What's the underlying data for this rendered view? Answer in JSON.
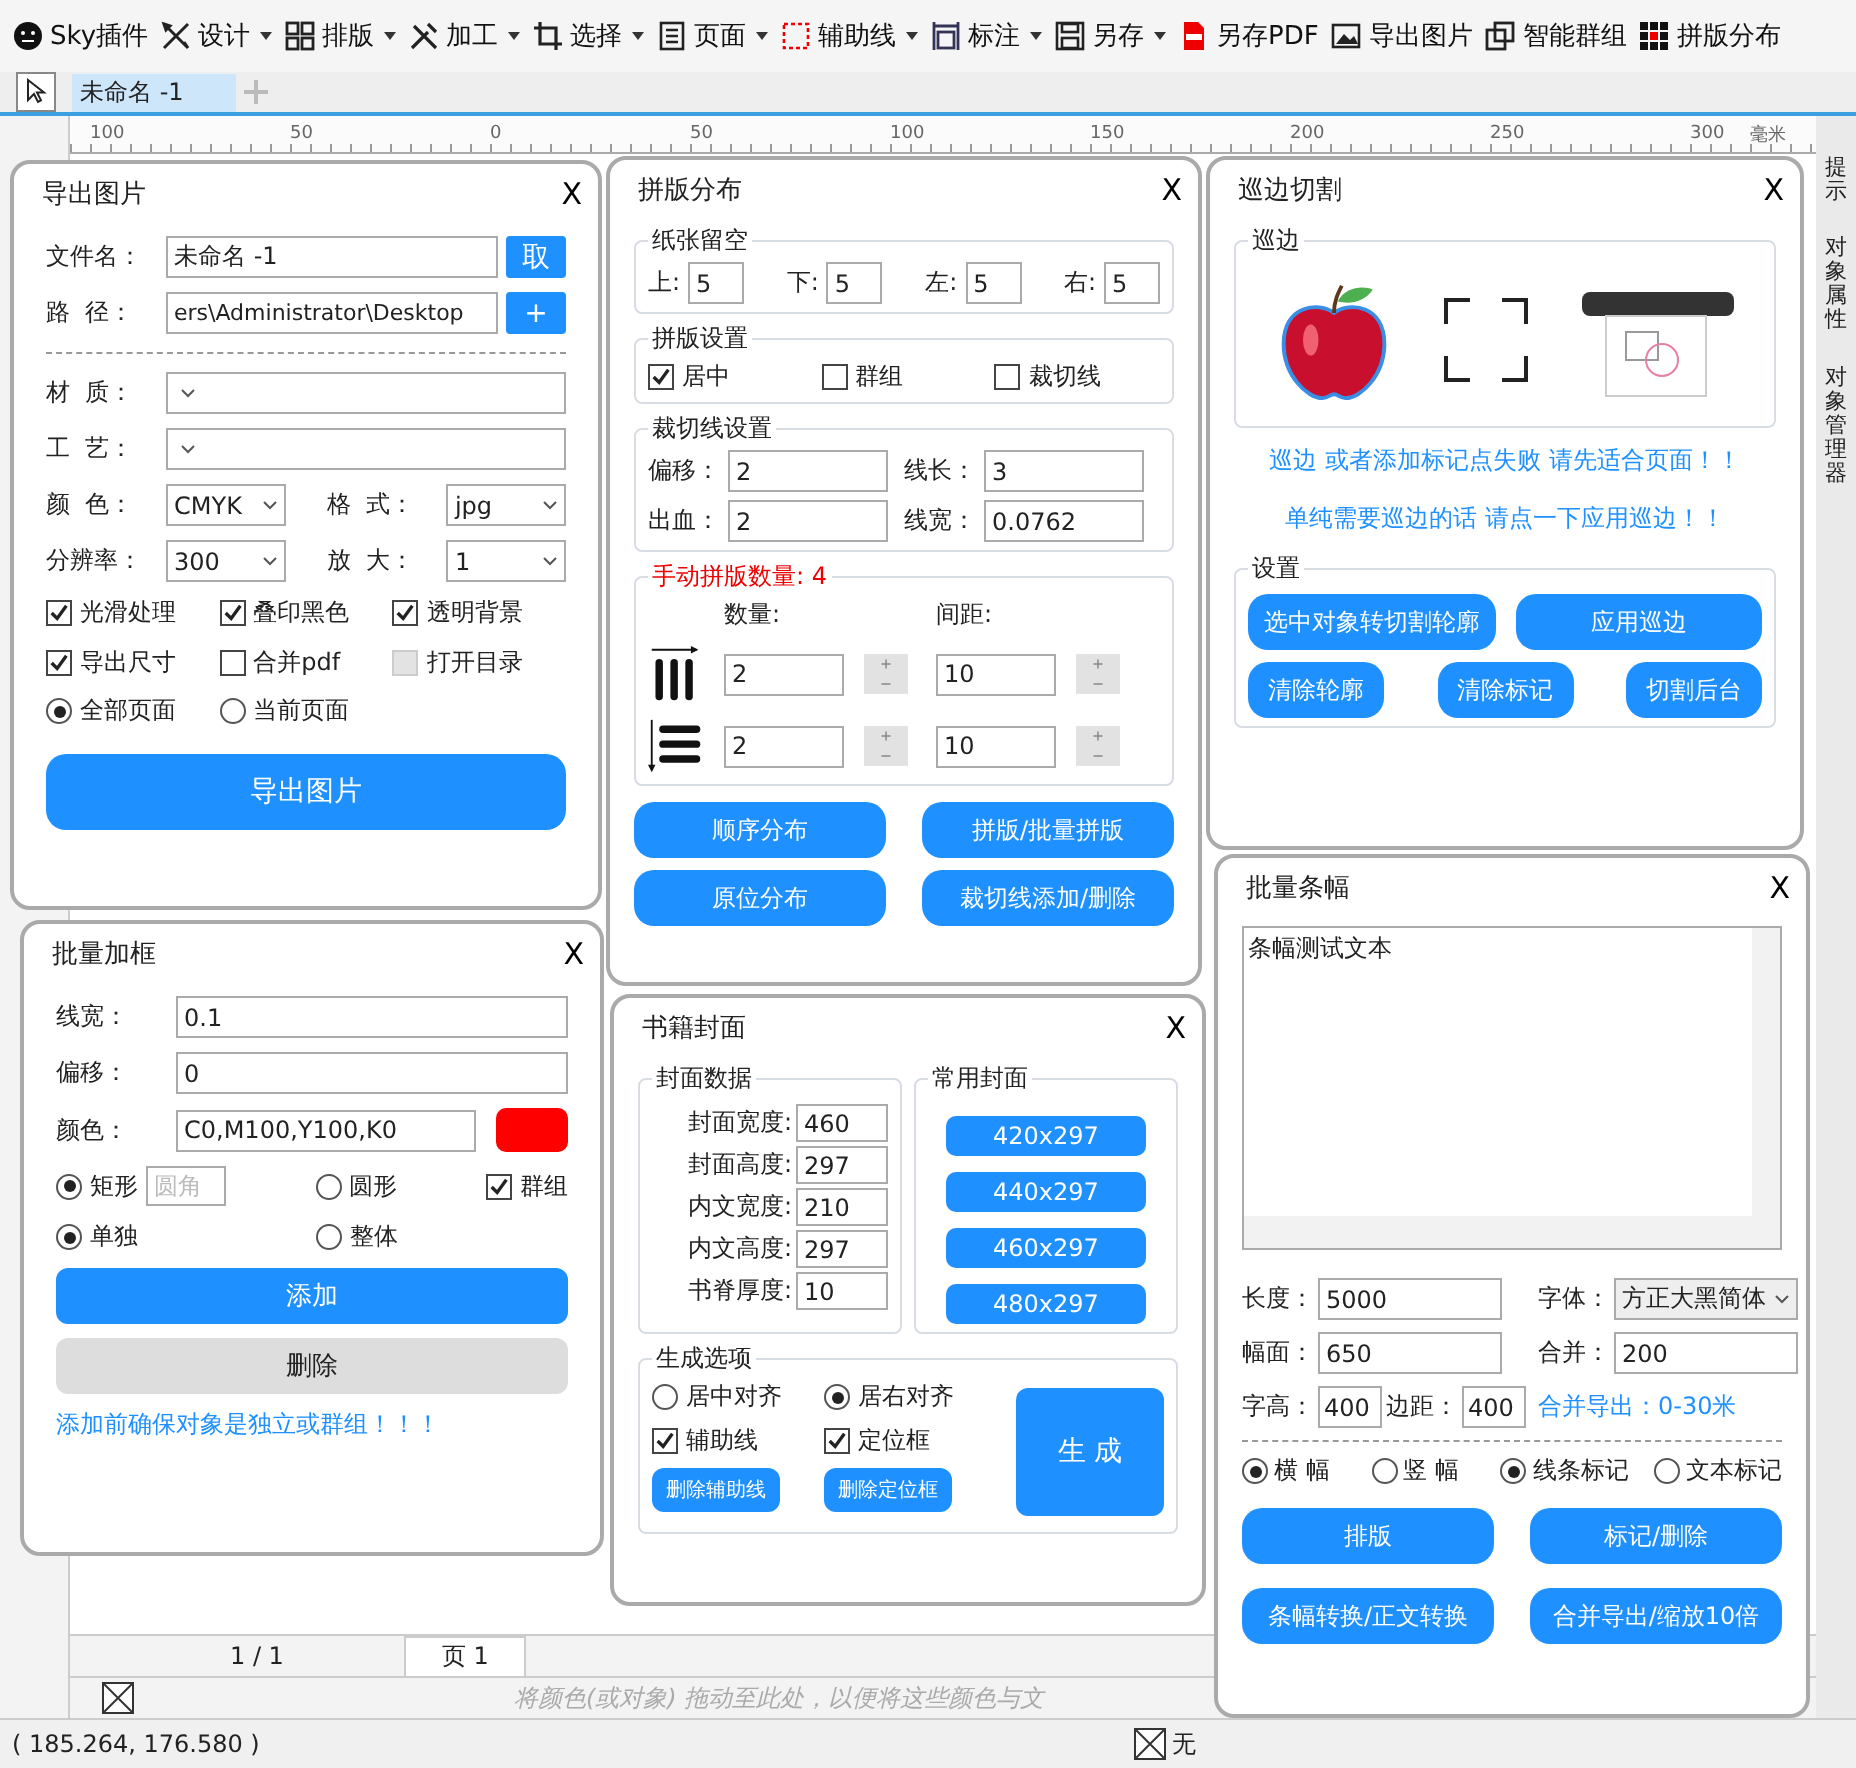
{
  "toolbar": [
    {
      "kind": "plugin",
      "label": "Sky插件",
      "menu": false
    },
    {
      "kind": "design",
      "label": "设计",
      "menu": true
    },
    {
      "kind": "layout",
      "label": "排版",
      "menu": true
    },
    {
      "kind": "process",
      "label": "加工",
      "menu": true
    },
    {
      "kind": "select",
      "label": "选择",
      "menu": true
    },
    {
      "kind": "page",
      "label": "页面",
      "menu": true
    },
    {
      "kind": "guides",
      "label": "辅助线",
      "menu": true
    },
    {
      "kind": "dimension",
      "label": "标注",
      "menu": true
    },
    {
      "kind": "save",
      "label": "另存",
      "menu": true
    },
    {
      "kind": "pdf",
      "label": "另存PDF",
      "menu": false
    },
    {
      "kind": "image",
      "label": "导出图片",
      "menu": false
    },
    {
      "kind": "group",
      "label": "智能群组",
      "menu": false
    },
    {
      "kind": "impose",
      "label": "拼版分布",
      "menu": false
    }
  ],
  "document_tabs": [
    {
      "label": "未命名 -1",
      "selected": true
    }
  ],
  "ruler": {
    "labels": [
      "100",
      "50",
      "0",
      "50",
      "100",
      "150",
      "200",
      "250",
      "300"
    ],
    "unit": "毫米"
  },
  "dockers": [
    "提示",
    "对象属性",
    "对象管理器"
  ],
  "export_panel": {
    "title": "导出图片",
    "close": "X",
    "file_name": {
      "label": "文件名：",
      "value": "未命名 -1",
      "button": "取"
    },
    "path": {
      "label": "路  径：",
      "value": "ers\\Administrator\\Desktop",
      "button": "+"
    },
    "material": {
      "label": "材  质："
    },
    "craft": {
      "label": "工  艺："
    },
    "color": {
      "label": "颜  色：",
      "value": "CMYK"
    },
    "format": {
      "label": "格  式：",
      "value": "jpg"
    },
    "resolution": {
      "label": "分辨率：",
      "value": "300"
    },
    "scale": {
      "label": "放  大：",
      "value": "1"
    },
    "options": [
      {
        "label": "光滑处理",
        "checked": true,
        "disabled": false
      },
      {
        "label": "叠印黑色",
        "checked": true,
        "disabled": false
      },
      {
        "label": "透明背景",
        "checked": true,
        "disabled": false
      },
      {
        "label": "导出尺寸",
        "checked": true,
        "disabled": false
      },
      {
        "label": "合并pdf",
        "checked": false,
        "disabled": false
      },
      {
        "label": "打开目录",
        "checked": false,
        "disabled": true
      }
    ],
    "pages": [
      {
        "label": "全部页面",
        "selected": true
      },
      {
        "label": "当前页面",
        "selected": false
      }
    ],
    "submit": "导出图片"
  },
  "frame_panel": {
    "title": "批量加框",
    "close": "X",
    "fields": [
      {
        "label": "线宽：",
        "value": "0.1"
      },
      {
        "label": "偏移：",
        "value": "0"
      },
      {
        "label": "颜色：",
        "value": "C0,M100,Y100,K0",
        "color": "#ff0000"
      }
    ],
    "shapes": [
      {
        "label": "矩形",
        "selected": true,
        "placeholder": "圆角"
      },
      {
        "label": "圆形",
        "selected": false
      }
    ],
    "group": {
      "label": "群组",
      "checked": true
    },
    "modes": [
      {
        "label": "单独",
        "selected": true
      },
      {
        "label": "整体",
        "selected": false
      }
    ],
    "buttons": [
      {
        "label": "添加",
        "kind": "primary"
      },
      {
        "label": "删除",
        "kind": "secondary"
      }
    ],
    "note": "添加前确保对象是独立或群组！！！"
  },
  "impose_panel": {
    "title": "拼版分布",
    "close": "X",
    "margins": {
      "title": "纸张留空",
      "items": [
        {
          "label": "上:",
          "value": "5"
        },
        {
          "label": "下:",
          "value": "5"
        },
        {
          "label": "左:",
          "value": "5"
        },
        {
          "label": "右:",
          "value": "5"
        }
      ]
    },
    "settings": {
      "title": "拼版设置",
      "items": [
        {
          "label": "居中",
          "checked": true
        },
        {
          "label": "群组",
          "checked": false
        },
        {
          "label": "裁切线",
          "checked": false
        }
      ]
    },
    "cut_lines": {
      "title": "裁切线设置",
      "items": [
        {
          "label": "偏移：",
          "value": "2"
        },
        {
          "label": "线长：",
          "value": "3"
        },
        {
          "label": "出血：",
          "value": "2"
        },
        {
          "label": "线宽：",
          "value": "0.0762"
        }
      ]
    },
    "manual": {
      "title": "手动拼版数量: 4",
      "count_header": "数量:",
      "gap_header": "间距:",
      "rows": [
        {
          "kind": "columns",
          "count": "2",
          "gap": "10"
        },
        {
          "kind": "rows",
          "count": "2",
          "gap": "10"
        }
      ]
    },
    "buttons": [
      "顺序分布",
      "拼版/批量拼版",
      "原位分布",
      "裁切线添加/删除"
    ]
  },
  "cover_panel": {
    "title": "书籍封面",
    "close": "X",
    "data": {
      "title": "封面数据",
      "items": [
        {
          "label": "封面宽度:",
          "value": "460"
        },
        {
          "label": "封面高度:",
          "value": "297"
        },
        {
          "label": "内文宽度:",
          "value": "210"
        },
        {
          "label": "内文高度:",
          "value": "297"
        },
        {
          "label": "书脊厚度:",
          "value": "10"
        }
      ]
    },
    "presets": {
      "title": "常用封面",
      "items": [
        "420x297",
        "440x297",
        "460x297",
        "480x297"
      ]
    },
    "options": {
      "title": "生成选项",
      "align": [
        {
          "label": "居中对齐",
          "selected": false
        },
        {
          "label": "居右对齐",
          "selected": true
        }
      ],
      "checks": [
        {
          "label": "辅助线",
          "checked": true
        },
        {
          "label": "定位框",
          "checked": true
        }
      ],
      "small_buttons": [
        "删除辅助线",
        "删除定位框"
      ],
      "generate": "生 成"
    }
  },
  "trace_panel": {
    "title": "巡边切割",
    "close": "X",
    "trace_group": "巡边",
    "notes": [
      "巡边 或者添加标记点失败 请先适合页面！！",
      "单纯需要巡边的话 请点一下应用巡边！！"
    ],
    "settings": {
      "title": "设置",
      "buttons": [
        "选中对象转切割轮廓",
        "应用巡边",
        "清除轮廓",
        "清除标记",
        "切割后台"
      ]
    }
  },
  "banner_panel": {
    "title": "批量条幅",
    "close": "X",
    "text": "条幅测试文本",
    "length": {
      "label": "长度：",
      "value": "5000"
    },
    "font": {
      "label": "字体：",
      "value": "方正大黑简体"
    },
    "width": {
      "label": "幅面：",
      "value": "650"
    },
    "merge": {
      "label": "合并：",
      "value": "200"
    },
    "char_height": {
      "label": "字高：",
      "value": "400"
    },
    "margin": {
      "label": "边距：",
      "value": "400"
    },
    "merge_note": "合并导出：0-30米",
    "orientation": [
      {
        "label": "横 幅",
        "selected": true
      },
      {
        "label": "竖 幅",
        "selected": false
      }
    ],
    "marks": [
      {
        "label": "线条标记",
        "selected": true
      },
      {
        "label": "文本标记",
        "selected": false
      }
    ],
    "buttons": [
      "排版",
      "标记/删除",
      "条幅转换/正文转换",
      "合并导出/缩放10倍"
    ]
  },
  "page_nav": {
    "counter": "1 / 1",
    "page_tab": "页 1"
  },
  "palette_hint": "将颜色(或对象) 拖动至此处，以便将这些颜色与文",
  "status": {
    "coordinates": "( 185.264, 176.580 )",
    "fill": "无"
  }
}
